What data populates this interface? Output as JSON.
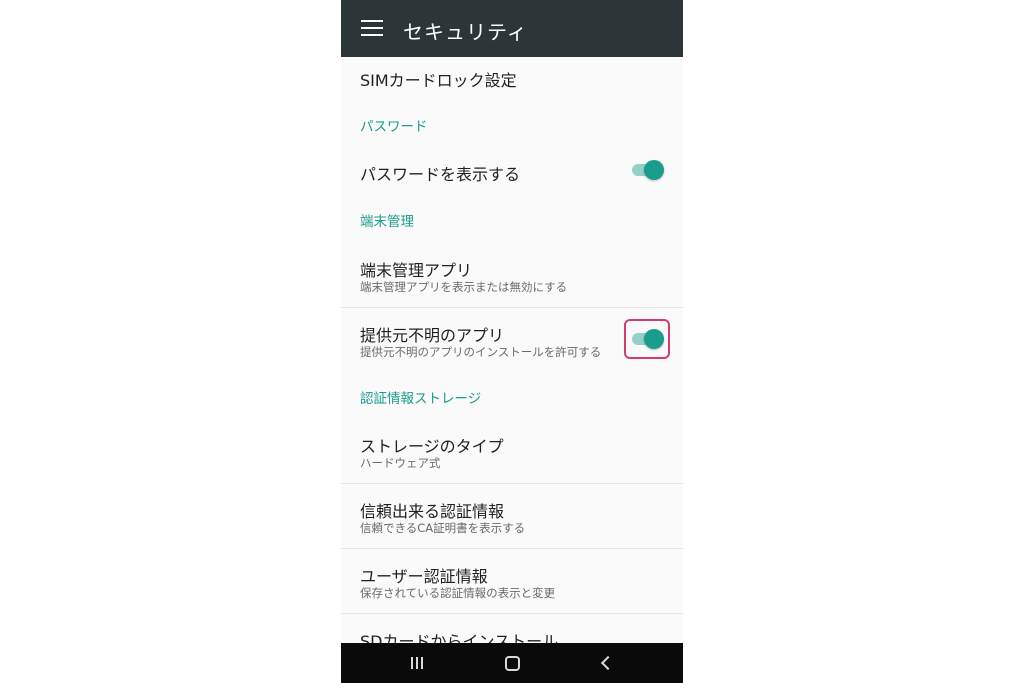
{
  "colors": {
    "appbar": "#2c3538",
    "accent": "#1a9d8c",
    "highlight": "#d63b6e",
    "navbar": "#0a0a0a"
  },
  "appbar": {
    "title": "セキュリティ",
    "menu_icon": "hamburger-menu-icon"
  },
  "items": {
    "sim_lock": {
      "title": "SIMカードロック設定"
    },
    "password_section": {
      "label": "パスワード"
    },
    "show_password": {
      "title": "パスワードを表示する",
      "toggle_on": true
    },
    "device_admin_section": {
      "label": "端末管理"
    },
    "device_admin_apps": {
      "title": "端末管理アプリ",
      "subtitle": "端末管理アプリを表示または無効にする"
    },
    "unknown_sources": {
      "title": "提供元不明のアプリ",
      "subtitle": "提供元不明のアプリのインストールを許可する",
      "toggle_on": true
    },
    "credential_section": {
      "label": "認証情報ストレージ"
    },
    "storage_type": {
      "title": "ストレージのタイプ",
      "subtitle": "ハードウェア式"
    },
    "trusted_credentials": {
      "title": "信頼出来る認証情報",
      "subtitle": "信頼できるCA証明書を表示する"
    },
    "user_credentials": {
      "title": "ユーザー認証情報",
      "subtitle": "保存されている認証情報の表示と変更"
    },
    "install_from_sd": {
      "title": "SDカードからインストール"
    }
  },
  "navbar": {
    "recents_icon": "recents-icon",
    "home_icon": "home-icon",
    "back_icon": "back-icon"
  }
}
